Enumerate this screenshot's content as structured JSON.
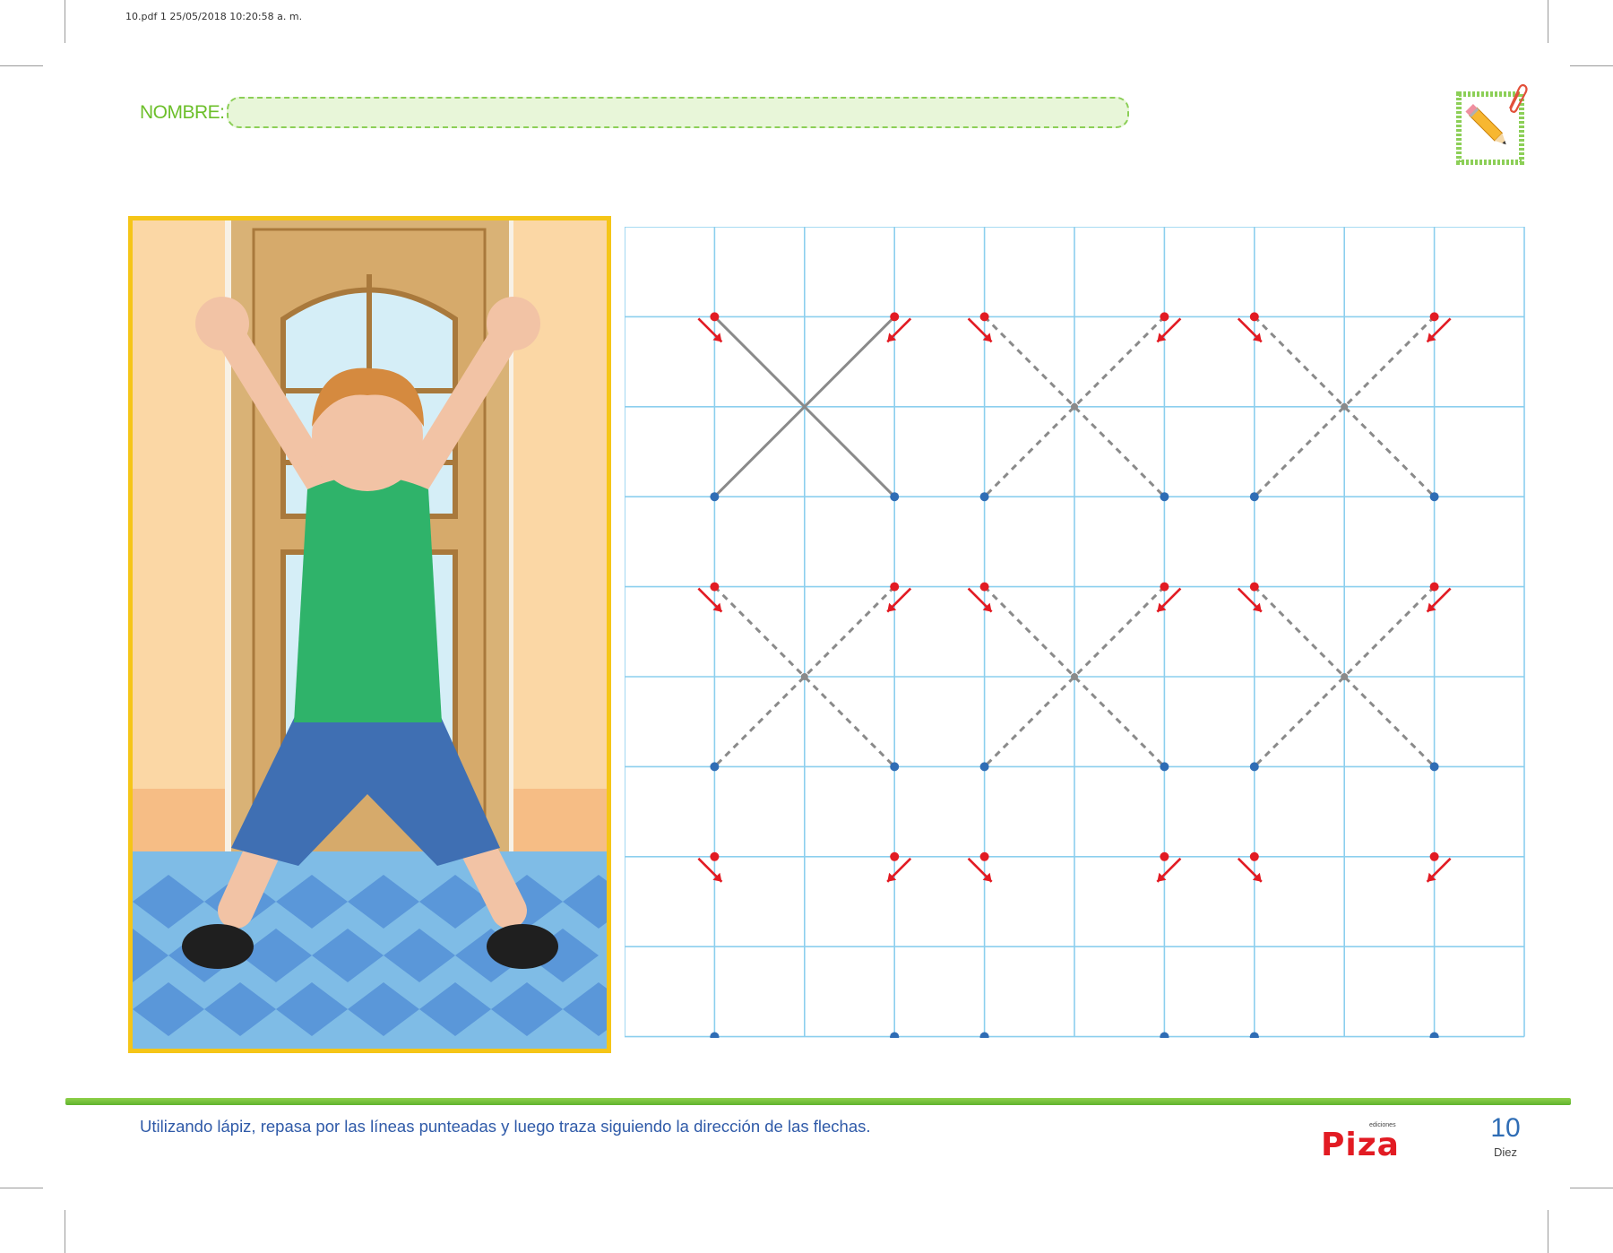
{
  "print_info": "10.pdf   1   25/05/2018   10:20:58 a. m.",
  "form": {
    "name_label": "NOMBRE:"
  },
  "icons": {
    "badge": "pencil-icon",
    "clip": "paperclip-icon"
  },
  "photo": {
    "description_icon": "child-jumping-illustration"
  },
  "worksheet": {
    "cols": 10,
    "rows": 9,
    "start_color": "#e21b23",
    "end_color": "#2f6db5",
    "grid_color": "#8ccfee",
    "trace_color": "#8a8a8a",
    "xs": [
      {
        "row": 1,
        "col": 1,
        "style": "solid"
      },
      {
        "row": 1,
        "col": 4,
        "style": "dashed"
      },
      {
        "row": 1,
        "col": 7,
        "style": "dashed"
      },
      {
        "row": 4,
        "col": 1,
        "style": "dashed"
      },
      {
        "row": 4,
        "col": 4,
        "style": "dashed"
      },
      {
        "row": 4,
        "col": 7,
        "style": "dashed"
      },
      {
        "row": 7,
        "col": 1,
        "style": "none"
      },
      {
        "row": 7,
        "col": 4,
        "style": "none"
      },
      {
        "row": 7,
        "col": 7,
        "style": "none"
      }
    ]
  },
  "footer": {
    "instruction": "Utilizando lápiz, repasa por las líneas punteadas y luego traza siguiendo la dirección de las flechas.",
    "brand_small": "ediciones",
    "brand": "Piza",
    "page_number": "10",
    "page_word": "Diez"
  },
  "colors": {
    "accent_green": "#6cbf2a",
    "accent_blue": "#2f5aa8",
    "brand_red": "#e21b23"
  }
}
